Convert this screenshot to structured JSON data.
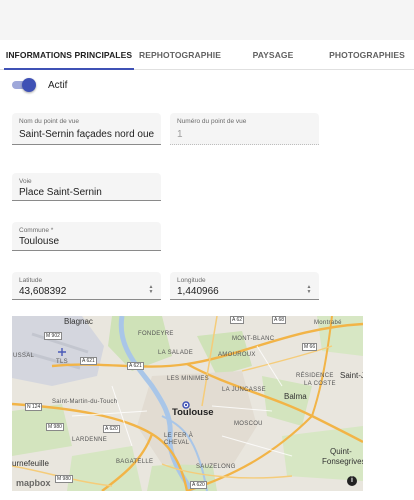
{
  "tabs": [
    {
      "label": "Informations principales"
    },
    {
      "label": "Rephotographie"
    },
    {
      "label": "Paysage"
    },
    {
      "label": "Photographies"
    }
  ],
  "toggle": {
    "label": "Actif",
    "on": true
  },
  "fields": {
    "nom": {
      "label": "Nom du point de vue",
      "value": "Saint-Sernin façades nord ouest"
    },
    "numero": {
      "label": "Numéro du point de vue",
      "value": "1"
    },
    "voie": {
      "label": "Voie",
      "value": "Place Saint-Sernin"
    },
    "commune": {
      "label": "Commune *",
      "value": "Toulouse"
    },
    "latitude": {
      "label": "Latitude",
      "value": "43,608392"
    },
    "longitude": {
      "label": "Longitude",
      "value": "1,440966"
    }
  },
  "map": {
    "places": {
      "blagnac": "Blagnac",
      "fondeyre": "FONDEYRE",
      "montrabe": "Montrabé",
      "montblanc": "MONT-BLANC",
      "lasalade": "LA SALADE",
      "amouroux": "AMOUROUX",
      "tls": "TLS",
      "ussal": "USSAL",
      "saintjean": "Saint-Jean",
      "lesminimes": "LES MINIMES",
      "residence": "RÉSIDENCE",
      "lacoste": "LA COSTE",
      "lajuncasse": "LA JUNCASSE",
      "balma": "Balma",
      "toulouse": "Toulouse",
      "saintmartin": "Saint-Martin-du-Touch",
      "moscou": "MOSCOU",
      "lardenne": "LARDENNE",
      "lefeda": "LE FER À",
      "cheval": "CHEVAL",
      "quint": "Quint-",
      "fonsegrives": "Fonsegrives",
      "tournefeuille": "urnefeuille",
      "bagatelle": "BAGATELLE",
      "sauzelong": "SAUZELONG"
    },
    "roads": {
      "a62": "A 62",
      "a68": "A 68",
      "m902": "M 902",
      "a621": "A 621",
      "a621b": "A 621",
      "m66": "M 66",
      "n124": "N 124",
      "m980": "M 980",
      "a620": "A 620",
      "m980b": "M 980",
      "a620b": "A 620"
    },
    "attribution": "mapbox",
    "info_icon": "i"
  }
}
